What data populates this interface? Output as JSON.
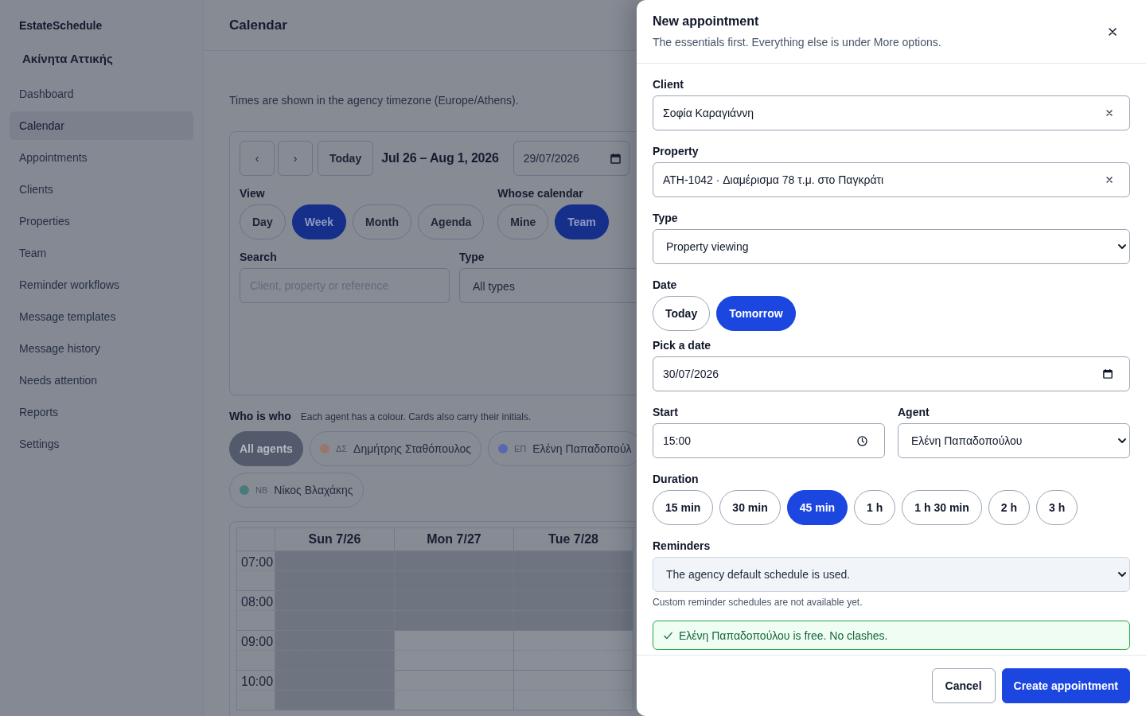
{
  "sidebar": {
    "app_name": "EstateSchedule",
    "agency": "Ακίνητα Αττικής",
    "items": [
      {
        "label": "Dashboard",
        "selected": false
      },
      {
        "label": "Calendar",
        "selected": true
      },
      {
        "label": "Appointments",
        "selected": false
      },
      {
        "label": "Clients",
        "selected": false
      },
      {
        "label": "Properties",
        "selected": false
      },
      {
        "label": "Team",
        "selected": false
      },
      {
        "label": "Reminder workflows",
        "selected": false
      },
      {
        "label": "Message templates",
        "selected": false
      },
      {
        "label": "Message history",
        "selected": false
      },
      {
        "label": "Needs attention",
        "selected": false
      },
      {
        "label": "Reports",
        "selected": false
      },
      {
        "label": "Settings",
        "selected": false
      }
    ]
  },
  "header": {
    "title": "Calendar"
  },
  "timezone_note": "Times are shown in the agency timezone (Europe/Athens).",
  "toolbar": {
    "prev": "‹",
    "next": "›",
    "today": "Today",
    "range": "Jul 26 – Aug 1, 2026",
    "date": "29/07/2026",
    "view_label": "View",
    "views": [
      {
        "label": "Day",
        "selected": false
      },
      {
        "label": "Week",
        "selected": true
      },
      {
        "label": "Month",
        "selected": false
      },
      {
        "label": "Agenda",
        "selected": false
      }
    ],
    "whose_label": "Whose calendar",
    "whose": [
      {
        "label": "Mine",
        "selected": false
      },
      {
        "label": "Team",
        "selected": true
      }
    ],
    "search_label": "Search",
    "search_placeholder": "Client, property or reference",
    "type_label": "Type",
    "type_value": "All types"
  },
  "legend": {
    "title": "Who is who",
    "note": "Each agent has a colour. Cards also carry their initials.",
    "agents": [
      {
        "kind": "all",
        "label": "All agents",
        "selected": true
      },
      {
        "kind": "agent",
        "initials": "ΔΣ",
        "label": "Δημήτρης Σταθόπουλος",
        "color": "#98776a",
        "selected": false
      },
      {
        "kind": "agent",
        "initials": "ΕΠ",
        "label": "Ελένη Παπαδοπούλ",
        "color": "#5868ae",
        "selected": false
      },
      {
        "kind": "agent",
        "initials": "NB",
        "label": "Νίκος Βλαχάκης",
        "color": "#4a7a7c",
        "selected": false
      }
    ]
  },
  "grid": {
    "days": [
      "Sun 7/26",
      "Mon 7/27",
      "Tue 7/28"
    ],
    "rows": [
      {
        "time": "07:00",
        "cells": [
          {
            "off_hours": true
          },
          {
            "off_hours": true
          },
          {
            "off_hours": true
          }
        ]
      },
      {
        "time": "08:00",
        "cells": [
          {
            "off_hours": true
          },
          {
            "off_hours": true
          },
          {
            "off_hours": true
          }
        ]
      },
      {
        "time": "09:00",
        "cells": [
          {
            "off_hours": true
          },
          {
            "off_hours": false
          },
          {
            "off_hours": false
          }
        ]
      },
      {
        "time": "10:00",
        "cells": [
          {
            "off_hours": true
          },
          {
            "off_hours": false
          },
          {
            "off_hours": false
          }
        ]
      }
    ]
  },
  "drawer": {
    "title": "New appointment",
    "subtitle": "The essentials first. Everything else is under More options.",
    "client": {
      "label": "Client",
      "value": "Σοφία Καραγιάννη"
    },
    "property": {
      "label": "Property",
      "value": "ATH-1042 · Διαμέρισμα 78 τ.μ. στο Παγκράτι"
    },
    "type": {
      "label": "Type",
      "value": "Property viewing"
    },
    "date": {
      "label": "Date",
      "options": [
        {
          "label": "Today",
          "selected": false
        },
        {
          "label": "Tomorrow",
          "selected": true
        }
      ],
      "pick_label": "Pick a date",
      "value": "30/07/2026"
    },
    "start": {
      "label": "Start",
      "value": "15:00"
    },
    "agent": {
      "label": "Agent",
      "value": "Ελένη Παπαδοπούλου"
    },
    "duration": {
      "label": "Duration",
      "options": [
        {
          "label": "15 min",
          "selected": false
        },
        {
          "label": "30 min",
          "selected": false
        },
        {
          "label": "45 min",
          "selected": true
        },
        {
          "label": "1 h",
          "selected": false
        },
        {
          "label": "1 h 30 min",
          "selected": false
        },
        {
          "label": "2 h",
          "selected": false
        },
        {
          "label": "3 h",
          "selected": false
        }
      ]
    },
    "reminders": {
      "label": "Reminders",
      "value": "The agency default schedule is used.",
      "disabled": true,
      "hint": "Custom reminder schedules are not available yet."
    },
    "availability": {
      "kind": "success",
      "message": "Ελένη Παπαδοπούλου is free. No clashes."
    },
    "buttons": {
      "cancel": "Cancel",
      "create": "Create appointment"
    }
  }
}
